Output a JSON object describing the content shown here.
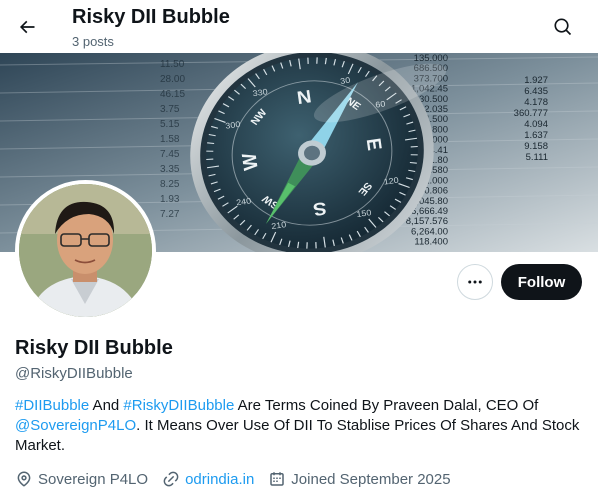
{
  "header": {
    "title": "Risky DII Bubble",
    "post_count": "3 posts",
    "back_icon": "arrow-left-icon",
    "search_icon": "search-icon"
  },
  "banner": {
    "description_icon": "compass-over-stock-table-image",
    "stock_numbers_left": [
      "11.50",
      "28.00",
      "46.15",
      "3.75",
      "5.15",
      "1.58",
      "7.45",
      "3.35",
      "8.25",
      "1.93",
      "7.27"
    ],
    "stock_numbers_right": [
      "135.000",
      "686.500",
      "373.700",
      "1,042.45",
      "230.500",
      "3,602.035",
      "194.500",
      "3,603.800",
      "900.000",
      "154,134.41",
      "1,451.80",
      "911.580",
      "612.000",
      "9,780.806",
      "6,045.80",
      "6,666.49",
      "8,157.576",
      "6,264.00",
      "118.400"
    ],
    "stock_numbers_far": [
      "1.927",
      "6.435",
      "4.178",
      "360.777",
      "4.094",
      "1.637",
      "9.158",
      "5.111"
    ],
    "compass_letters": [
      "N",
      "E",
      "S",
      "W",
      "NE",
      "SE",
      "SW",
      "NW"
    ],
    "compass_degrees": [
      "300",
      "330",
      "30",
      "60",
      "120",
      "150",
      "210",
      "240"
    ]
  },
  "profile": {
    "avatar_icon": "avatar-photo",
    "display_name": "Risky DII Bubble",
    "handle": "@RiskyDIIBubble",
    "follow_label": "Follow",
    "more_icon": "more-horizontal-icon"
  },
  "bio": {
    "tag1": "#DIIBubble",
    "text1": " And ",
    "tag2": "#RiskyDIIBubble",
    "text2": " Are Terms Coined By Praveen Dalal, CEO Of ",
    "mention": "@SovereignP4LO",
    "text3": ". It Means Over Use Of DII To Stablise Prices Of Shares And Stock Market."
  },
  "meta": {
    "location_icon": "location-pin-icon",
    "location": "Sovereign P4LO",
    "link_icon": "link-icon",
    "website": "odrindia.in",
    "calendar_icon": "calendar-icon",
    "joined": "Joined September 2025"
  },
  "colors": {
    "accent": "#1d9bf0",
    "text": "#0f1419",
    "secondary": "#536471",
    "follow_bg": "#0f1419"
  }
}
